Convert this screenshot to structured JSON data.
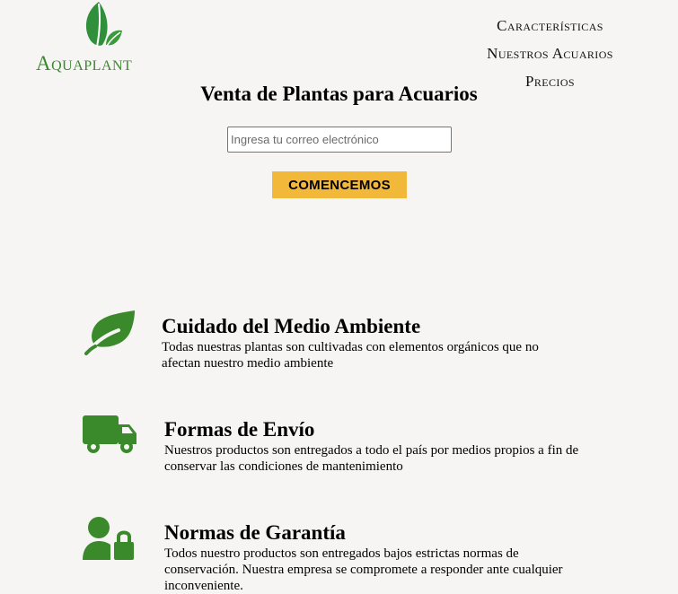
{
  "brand": {
    "name": "Aquaplant",
    "color": "#3a8a2c"
  },
  "nav": {
    "items": [
      {
        "label": "Características"
      },
      {
        "label": "Nuestros Acuarios"
      },
      {
        "label": "Precios"
      }
    ]
  },
  "hero": {
    "title": "Venta de Plantas para Acuarios",
    "email_placeholder": "Ingresa tu correo electrónico",
    "cta_label": "COMENCEMOS",
    "cta_color": "#f2b83a"
  },
  "features": [
    {
      "icon": "leaf-icon",
      "title": "Cuidado del Medio Ambiente",
      "text": "Todas nuestras plantas son cultivadas con elementos orgánicos que no afectan nuestro medio ambiente"
    },
    {
      "icon": "truck-icon",
      "title": "Formas de Envío",
      "text": "Nuestros productos son entregados a todo el país por medios propios a fin de conservar las condiciones de mantenimiento"
    },
    {
      "icon": "user-lock-icon",
      "title": "Normas de Garantía",
      "text": "Todos nuestro productos son entregados bajos estrictas normas de conservación. Nuestra empresa se compromete a responder ante cualquier inconveniente."
    }
  ]
}
